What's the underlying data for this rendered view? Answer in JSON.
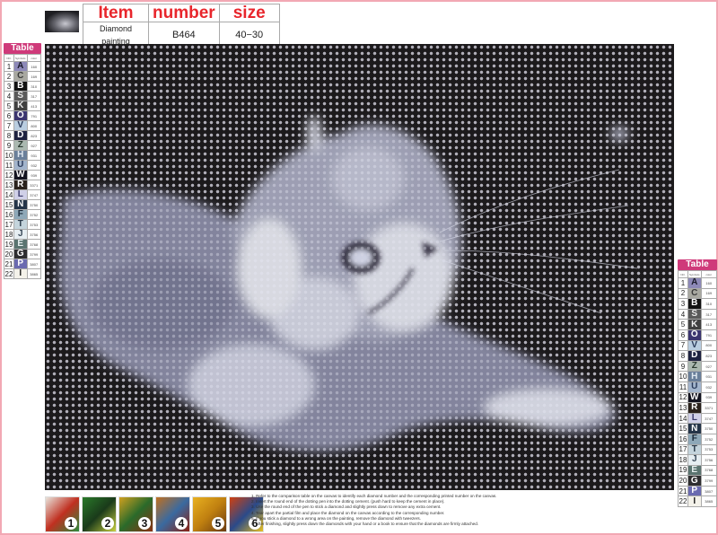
{
  "header": {
    "columns": [
      "Item",
      "number",
      "size"
    ],
    "values": [
      "Diamond painting",
      "B464",
      "40−30"
    ]
  },
  "color_table": {
    "title": "Table",
    "headers": [
      "NO.",
      "Symbols",
      "color"
    ],
    "rows": [
      {
        "no": "1",
        "symbol": "A",
        "color": "160",
        "bg": "#8d89b8",
        "fg": "#1a1a2a"
      },
      {
        "no": "2",
        "symbol": "C",
        "color": "169",
        "bg": "#a8a8a0",
        "fg": "#3a3a3a"
      },
      {
        "no": "3",
        "symbol": "B",
        "color": "310",
        "bg": "#121212",
        "fg": "#ffffff"
      },
      {
        "no": "4",
        "symbol": "S",
        "color": "317",
        "bg": "#5a5a5a",
        "fg": "#e8e8e8"
      },
      {
        "no": "5",
        "symbol": "K",
        "color": "413",
        "bg": "#404040",
        "fg": "#f0f0f0"
      },
      {
        "no": "6",
        "symbol": "O",
        "color": "791",
        "bg": "#3b3570",
        "fg": "#ffffff"
      },
      {
        "no": "7",
        "symbol": "V",
        "color": "800",
        "bg": "#b9cde0",
        "fg": "#2a3a5a"
      },
      {
        "no": "8",
        "symbol": "D",
        "color": "823",
        "bg": "#1e2240",
        "fg": "#ffffff"
      },
      {
        "no": "9",
        "symbol": "Z",
        "color": "927",
        "bg": "#aab8b0",
        "fg": "#2a3a30"
      },
      {
        "no": "10",
        "symbol": "H",
        "color": "931",
        "bg": "#6a7f9a",
        "fg": "#e0e8f0"
      },
      {
        "no": "11",
        "symbol": "U",
        "color": "932",
        "bg": "#a2b4cc",
        "fg": "#2a3a5a"
      },
      {
        "no": "12",
        "symbol": "W",
        "color": "939",
        "bg": "#141420",
        "fg": "#ffffff"
      },
      {
        "no": "13",
        "symbol": "R",
        "color": "3371",
        "bg": "#2a221c",
        "fg": "#ffffff"
      },
      {
        "no": "14",
        "symbol": "L",
        "color": "3747",
        "bg": "#d0d0e8",
        "fg": "#3a3a6a"
      },
      {
        "no": "15",
        "symbol": "N",
        "color": "3750",
        "bg": "#243448",
        "fg": "#ffffff"
      },
      {
        "no": "16",
        "symbol": "F",
        "color": "3752",
        "bg": "#8ea8b8",
        "fg": "#1a2a3a"
      },
      {
        "no": "17",
        "symbol": "T",
        "color": "3753",
        "bg": "#c4d4dc",
        "fg": "#2a3a4a"
      },
      {
        "no": "18",
        "symbol": "J",
        "color": "3756",
        "bg": "#e6eef2",
        "fg": "#3a4a5a"
      },
      {
        "no": "19",
        "symbol": "E",
        "color": "3768",
        "bg": "#5a7470",
        "fg": "#e8f0f0"
      },
      {
        "no": "20",
        "symbol": "G",
        "color": "3799",
        "bg": "#2e2e30",
        "fg": "#ffffff"
      },
      {
        "no": "21",
        "symbol": "P",
        "color": "3807",
        "bg": "#6a6ab0",
        "fg": "#ffffff"
      },
      {
        "no": "22",
        "symbol": "I",
        "color": "3865",
        "bg": "#f4f2ea",
        "fg": "#222222"
      }
    ]
  },
  "canvas": {
    "subject": "Grey cat with butterfly diamond painting pattern",
    "background_color": "#1c1a1c",
    "dot_color": "#9a98a0",
    "light_tone": "#e8eaf2",
    "mid_tone": "#9a9cb0",
    "accent_tone": "#8a7fc8"
  },
  "steps": {
    "numbers": [
      "1",
      "2",
      "3",
      "4",
      "5",
      "6"
    ],
    "colors": [
      [
        "#e8e4dc",
        "#c03020",
        "#2a8a3a"
      ],
      [
        "#2a7a2a",
        "#1a3a1a",
        "#c8d040"
      ],
      [
        "#d0a020",
        "#2a6a2a",
        "#8a3010"
      ],
      [
        "#c07020",
        "#3a6aa0",
        "#8a2010"
      ],
      [
        "#e8b020",
        "#c08010",
        "#6a3a10"
      ],
      [
        "#d04010",
        "#2a4a8a",
        "#e8c020"
      ]
    ]
  },
  "instructions": [
    "1. Refer to the comparison table on the canvas to identify each diamond number and the corresponding printed number on the canvas.",
    "2. Insert the round end of the dotting pen into the dotting cement. (push hard to keep the cement in place).",
    "3. Use the round end of the pen to stick a diamond and slightly press down to remove any extra cement.",
    "4. Tear apart the partial film and place the diamond on the canvas according to the corresponding number.",
    "5. If you stick a diamond to a wrong area on the painting, remove the diamond with tweezers.",
    "6. After finishing, slightly press down the diamonds with your hand or a book to ensure that the diamonds are firmly attached."
  ]
}
